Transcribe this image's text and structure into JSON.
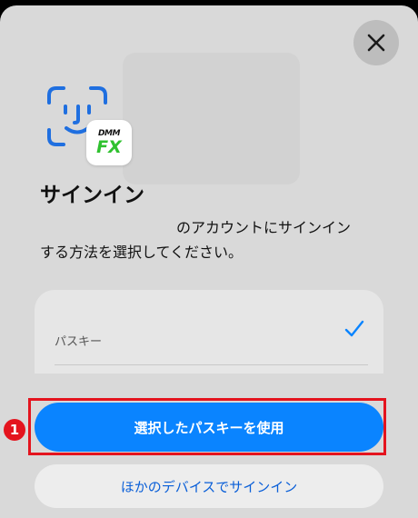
{
  "dialog": {
    "title": "サインイン",
    "description_line1": "のアカウントにサインイン",
    "description_line2": "する方法を選択してください。",
    "close_icon": "close-icon"
  },
  "app": {
    "brand_top": "DMM",
    "brand_fx": "FX"
  },
  "passkey_list": {
    "item_label": "パスキー",
    "selected": true
  },
  "actions": {
    "primary_label": "選択したパスキーを使用",
    "secondary_label": "ほかのデバイスでサインイン"
  },
  "annotation": {
    "step_number": "1"
  },
  "colors": {
    "accent": "#0a84ff",
    "highlight": "#e4141e",
    "faceid_blue": "#1f6fe0",
    "fx_green": "#2fc12f"
  }
}
